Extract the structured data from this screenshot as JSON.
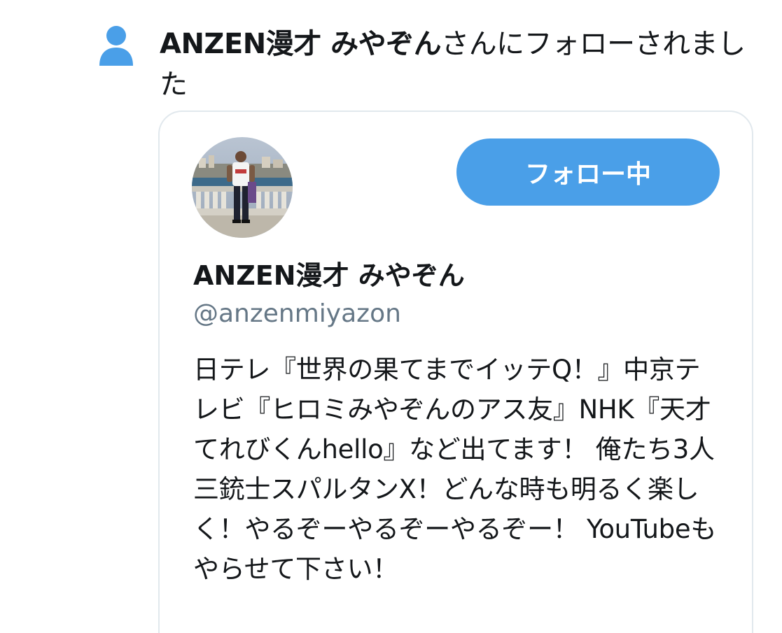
{
  "notification": {
    "icon": "person-icon",
    "actor": "ANZEN漫才 みやぞん",
    "action": "さんにフォローされました"
  },
  "profile_card": {
    "avatar": "avatar-photo",
    "follow_button_label": "フォロー中",
    "display_name": "ANZEN漫才 みやぞん",
    "handle": "@anzenmiyazon",
    "bio": "日テレ『世界の果てまでイッテQ！』中京テレビ『ヒロミみやぞんのアス友』NHK『天才てれびくんhello』など出てます！ 俺たち3人三銃士スパルタンX！どんな時も明るく楽しく！やるぞーやるぞーやるぞー！ YouTubeもやらせて下さい！"
  },
  "colors": {
    "accent": "#4a9fe8",
    "handle": "#657786",
    "border": "#e1e8ed",
    "text": "#14171a"
  }
}
